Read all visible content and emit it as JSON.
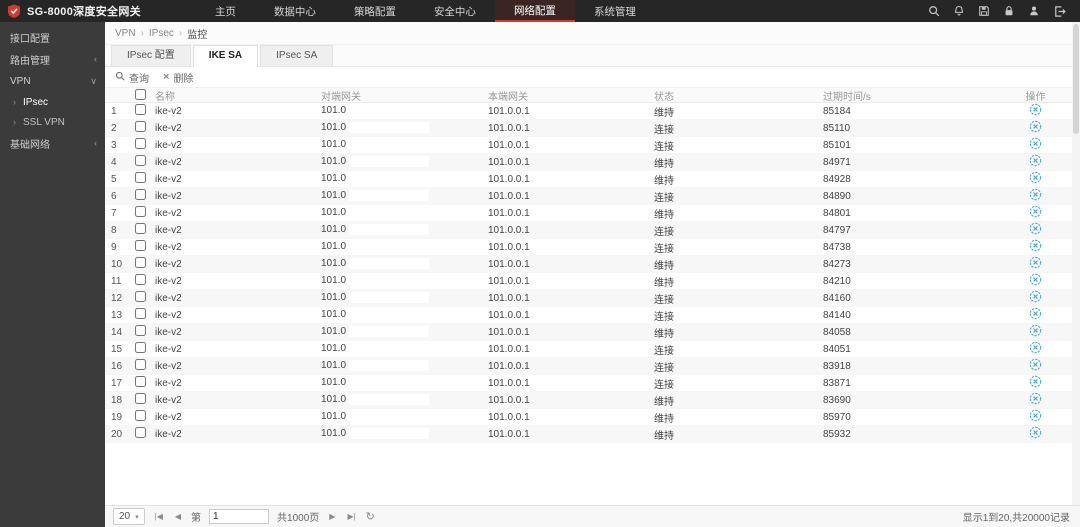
{
  "app": {
    "title": "SG-8000深度安全网关"
  },
  "topnav": {
    "items": [
      "主页",
      "数据中心",
      "策略配置",
      "安全中心",
      "网络配置",
      "系统管理"
    ],
    "active_index": 4,
    "icons": [
      "search-icon",
      "bell-icon",
      "save-icon",
      "lock-icon",
      "user-icon",
      "logout-icon"
    ]
  },
  "sidebar": {
    "items": [
      {
        "label": "接口配置",
        "type": "root",
        "chevron": "none"
      },
      {
        "label": "路由管理",
        "type": "root",
        "chevron": "left"
      },
      {
        "label": "VPN",
        "type": "root",
        "chevron": "down",
        "expanded": true
      },
      {
        "label": "IPsec",
        "type": "child",
        "active": true
      },
      {
        "label": "SSL VPN",
        "type": "child",
        "active": false
      },
      {
        "label": "基础网络",
        "type": "root",
        "chevron": "left"
      }
    ]
  },
  "breadcrumb": {
    "items": [
      "VPN",
      "IPsec",
      "监控"
    ],
    "separator": "›"
  },
  "tabs": {
    "items": [
      {
        "label": "IPsec 配置",
        "active": false
      },
      {
        "label": "IKE SA",
        "active": true
      },
      {
        "label": "IPsec SA",
        "active": false
      }
    ]
  },
  "toolbar": {
    "query_label": "查询",
    "delete_label": "删除"
  },
  "table": {
    "headers": {
      "name": "名称",
      "peer_gateway": "对端网关",
      "local_gateway": "本端网关",
      "status": "状态",
      "expire_time": "过期时间/s",
      "operation": "操作"
    },
    "rows": [
      {
        "index": 1,
        "name": "ike-v2",
        "peer_gateway": "101.0",
        "local_gateway": "101.0.0.1",
        "status": "维持",
        "expire_time": "85184"
      },
      {
        "index": 2,
        "name": "ike-v2",
        "peer_gateway": "101.0",
        "local_gateway": "101.0.0.1",
        "status": "连接",
        "expire_time": "85110"
      },
      {
        "index": 3,
        "name": "ike-v2",
        "peer_gateway": "101.0",
        "local_gateway": "101.0.0.1",
        "status": "连接",
        "expire_time": "85101"
      },
      {
        "index": 4,
        "name": "ike-v2",
        "peer_gateway": "101.0",
        "local_gateway": "101.0.0.1",
        "status": "维持",
        "expire_time": "84971"
      },
      {
        "index": 5,
        "name": "ike-v2",
        "peer_gateway": "101.0",
        "local_gateway": "101.0.0.1",
        "status": "维持",
        "expire_time": "84928"
      },
      {
        "index": 6,
        "name": "ike-v2",
        "peer_gateway": "101.0",
        "local_gateway": "101.0.0.1",
        "status": "连接",
        "expire_time": "84890"
      },
      {
        "index": 7,
        "name": "ike-v2",
        "peer_gateway": "101.0",
        "local_gateway": "101.0.0.1",
        "status": "维持",
        "expire_time": "84801"
      },
      {
        "index": 8,
        "name": "ike-v2",
        "peer_gateway": "101.0",
        "local_gateway": "101.0.0.1",
        "status": "连接",
        "expire_time": "84797"
      },
      {
        "index": 9,
        "name": "ike-v2",
        "peer_gateway": "101.0",
        "local_gateway": "101.0.0.1",
        "status": "连接",
        "expire_time": "84738"
      },
      {
        "index": 10,
        "name": "ike-v2",
        "peer_gateway": "101.0",
        "local_gateway": "101.0.0.1",
        "status": "维持",
        "expire_time": "84273"
      },
      {
        "index": 11,
        "name": "ike-v2",
        "peer_gateway": "101.0",
        "local_gateway": "101.0.0.1",
        "status": "维持",
        "expire_time": "84210"
      },
      {
        "index": 12,
        "name": "ike-v2",
        "peer_gateway": "101.0",
        "local_gateway": "101.0.0.1",
        "status": "连接",
        "expire_time": "84160"
      },
      {
        "index": 13,
        "name": "ike-v2",
        "peer_gateway": "101.0",
        "local_gateway": "101.0.0.1",
        "status": "连接",
        "expire_time": "84140"
      },
      {
        "index": 14,
        "name": "ike-v2",
        "peer_gateway": "101.0",
        "local_gateway": "101.0.0.1",
        "status": "维持",
        "expire_time": "84058"
      },
      {
        "index": 15,
        "name": "ike-v2",
        "peer_gateway": "101.0",
        "local_gateway": "101.0.0.1",
        "status": "连接",
        "expire_time": "84051"
      },
      {
        "index": 16,
        "name": "ike-v2",
        "peer_gateway": "101.0",
        "local_gateway": "101.0.0.1",
        "status": "连接",
        "expire_time": "83918"
      },
      {
        "index": 17,
        "name": "ike-v2",
        "peer_gateway": "101.0",
        "local_gateway": "101.0.0.1",
        "status": "连接",
        "expire_time": "83871"
      },
      {
        "index": 18,
        "name": "ike-v2",
        "peer_gateway": "101.0",
        "local_gateway": "101.0.0.1",
        "status": "维持",
        "expire_time": "83690"
      },
      {
        "index": 19,
        "name": "ike-v2",
        "peer_gateway": "101.0",
        "local_gateway": "101.0.0.1",
        "status": "维持",
        "expire_time": "85970"
      },
      {
        "index": 20,
        "name": "ike-v2",
        "peer_gateway": "101.0",
        "local_gateway": "101.0.0.1",
        "status": "维持",
        "expire_time": "85932"
      }
    ],
    "operation_icon": "disconnect-icon"
  },
  "pagination": {
    "page_size": "20",
    "page_label_prefix": "第",
    "page_value": "1",
    "total_pages_label": "共1000页",
    "summary": "显示1到20,共20000记录",
    "icons": [
      "first-page-icon",
      "prev-page-icon",
      "next-page-icon",
      "last-page-icon",
      "refresh-icon"
    ]
  },
  "colors": {
    "accent_red": "#cf3a32",
    "link_blue": "#4aa8da",
    "topbar_bg": "#262626",
    "sidebar_bg": "#3b3b3b"
  }
}
